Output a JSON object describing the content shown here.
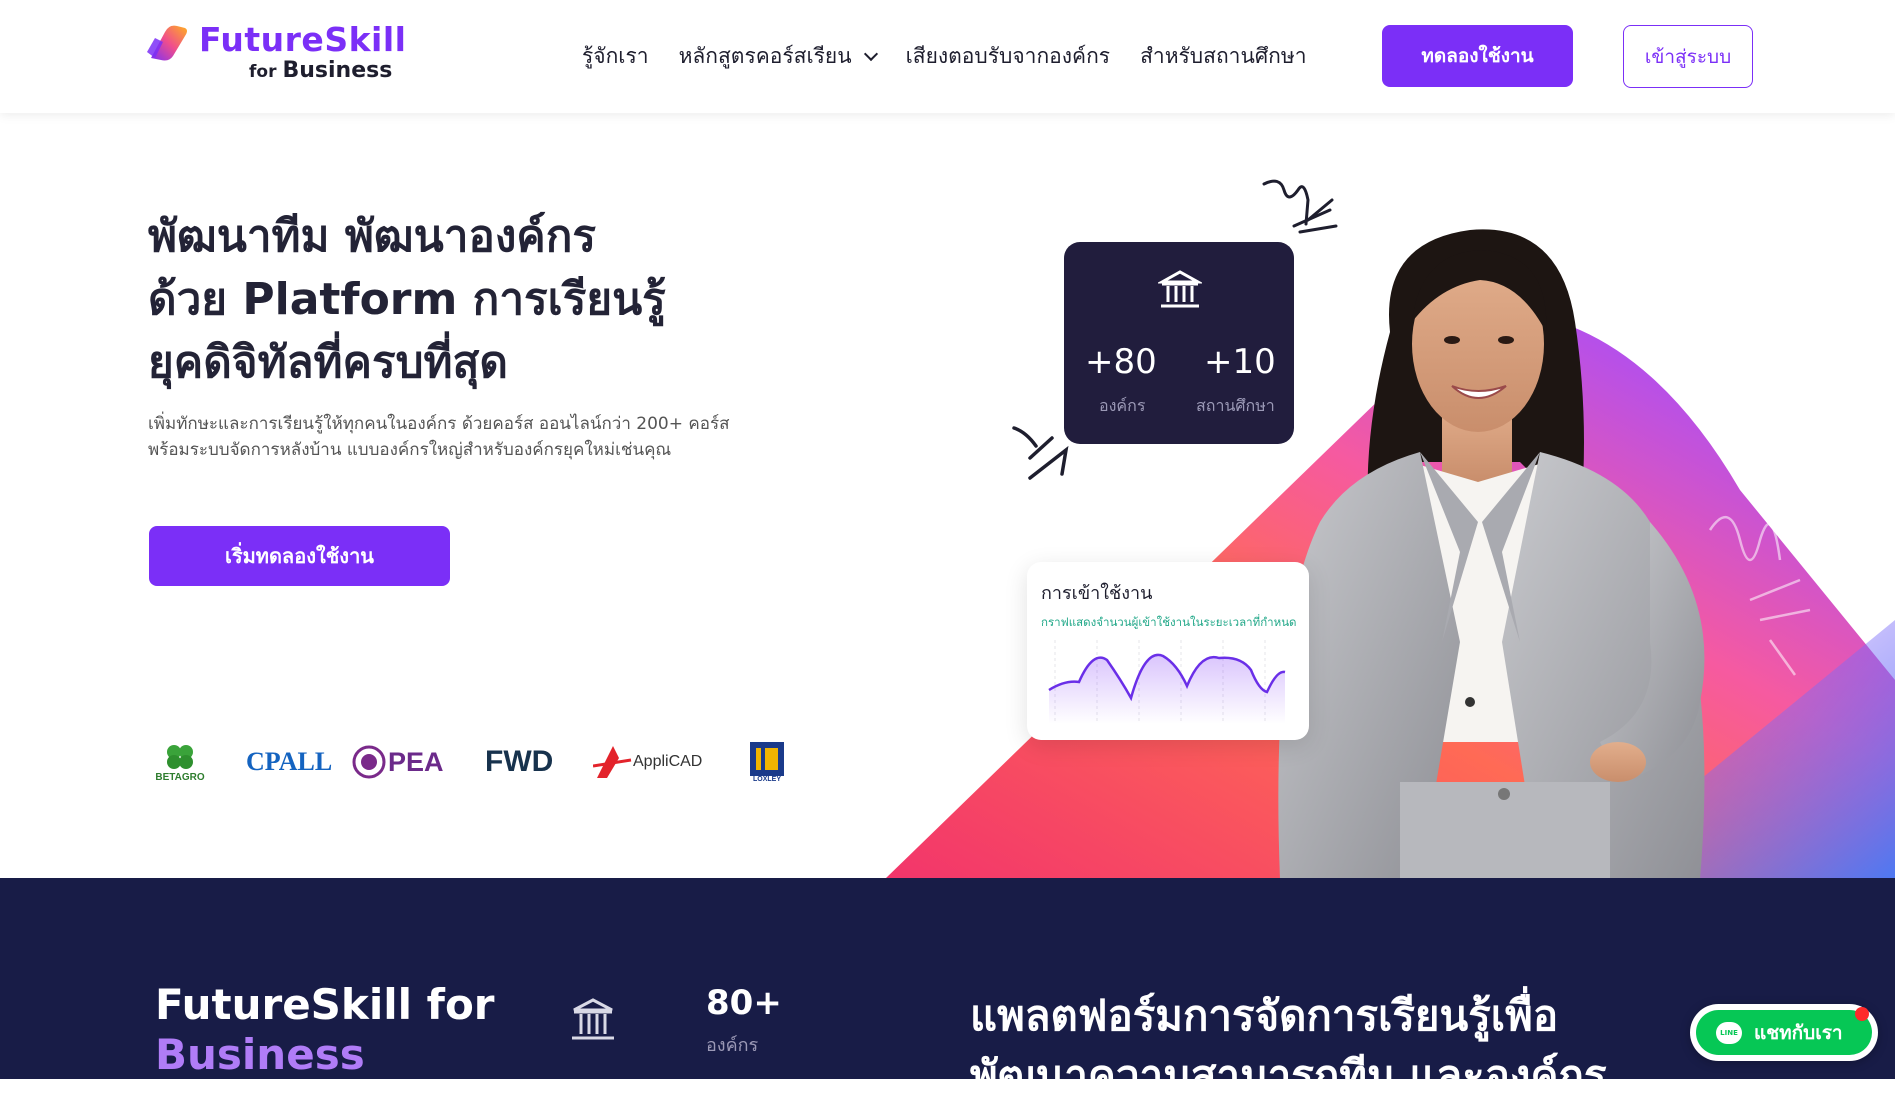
{
  "nav": {
    "logo_text": "FutureSkill",
    "logo_for": "for",
    "logo_business": "Business",
    "links": [
      "รู้จักเรา",
      "หลักสูตรคอร์สเรียน",
      "เสียงตอบรับจากองค์กร",
      "สำหรับสถานศึกษา"
    ],
    "trial_button": "ทดลองใช้งาน",
    "login_button": "เข้าสู่ระบบ"
  },
  "hero": {
    "title_line1": "พัฒนาทีม พัฒนาองค์กร",
    "title_line2": "ด้วย Platform การเรียนรู้",
    "title_line3": "ยุคดิจิทัลที่ครบที่สุด",
    "desc_line1": "เพิ่มทักษะและการเรียนรู้ให้ทุกคนในองค์กร ด้วยคอร์ส ออนไลน์กว่า 200+ คอร์ส",
    "desc_line2": "พร้อมระบบจัดการหลังบ้าน แบบองค์กรใหญ่สำหรับองค์กรยุคใหม่เช่นคุณ",
    "start_button": "เริ่มทดลองใช้งาน",
    "partners": [
      "BETAGRO",
      "CPALL",
      "PEA",
      "FWD",
      "AppliCAD",
      "LOXLEY"
    ]
  },
  "stats_card": {
    "org_value": "+80",
    "org_label": "องค์กร",
    "edu_value": "+10",
    "edu_label": "สถานศึกษา"
  },
  "usage_card": {
    "title": "การเข้าใช้งาน",
    "subtitle": "กราฟแสดงจำนวนผู้เข้าใช้งานในระยะเวลาที่กำหนด"
  },
  "dark_section": {
    "brand_line1": "FutureSkill for",
    "brand_line2": "Business",
    "stat_value": "80+",
    "stat_label": "องค์กร",
    "heading_line1": "แพลตฟอร์มการจัดการเรียนรู้เพื่อ",
    "heading_line2": "พัฒนาความสามารถทีม และองค์กร"
  },
  "chat": {
    "label": "แชทกับเรา",
    "icon_text": "LINE"
  },
  "colors": {
    "accent": "#7b2ff7",
    "dark_navy": "#181c47",
    "card_dark": "#211d3d",
    "line_green": "#06c755"
  }
}
